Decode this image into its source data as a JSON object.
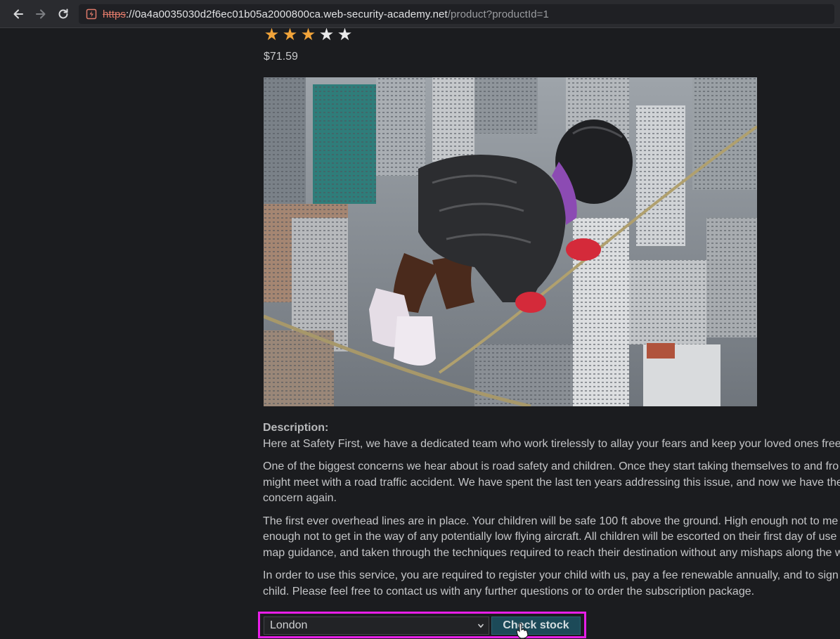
{
  "browser": {
    "url_scheme": "https",
    "url_host": "://0a4a0035030d2f6ec01b05a2000800ca.web-security-academy.net",
    "url_path": "/product?productId=1",
    "back_icon": "arrow-left-icon",
    "forward_icon": "arrow-right-icon",
    "reload_icon": "reload-icon"
  },
  "product": {
    "rating": 3,
    "rating_max": 5,
    "price": "$71.59",
    "image_alt": "Child walking on a tightrope above city skyscrapers"
  },
  "description": {
    "heading": "Description:",
    "paragraphs": [
      [
        "Here at Safety First, we have a dedicated team who work tirelessly to allay your fears and keep your loved ones free"
      ],
      [
        "One of the biggest concerns we hear about is road safety and children. Once they start taking themselves to and fro",
        "might meet with a road traffic accident. We have spent the last ten years addressing this issue, and now we have the",
        "concern again."
      ],
      [
        "The first ever overhead lines are in place. Your children will be safe 100 ft above the ground. High enough not to me",
        "enough not to get in the way of any potentially low flying aircraft. All children will be escorted on their first day of use",
        "map guidance, and taken through the techniques required to reach their destination without any mishaps along the w"
      ],
      [
        "In order to use this service, you are required to register your child with us, pay a fee renewable annually, and to sign",
        "child. Please feel free to contact us with any further questions or to order the subscription package."
      ]
    ]
  },
  "stock_check": {
    "selected_store": "London",
    "button_label": "Check stock"
  },
  "colors": {
    "star_filled": "#f1a43a",
    "star_empty": "#e9e9ea",
    "highlight_border": "#e81ee8",
    "button_bg": "#1c4a58"
  }
}
